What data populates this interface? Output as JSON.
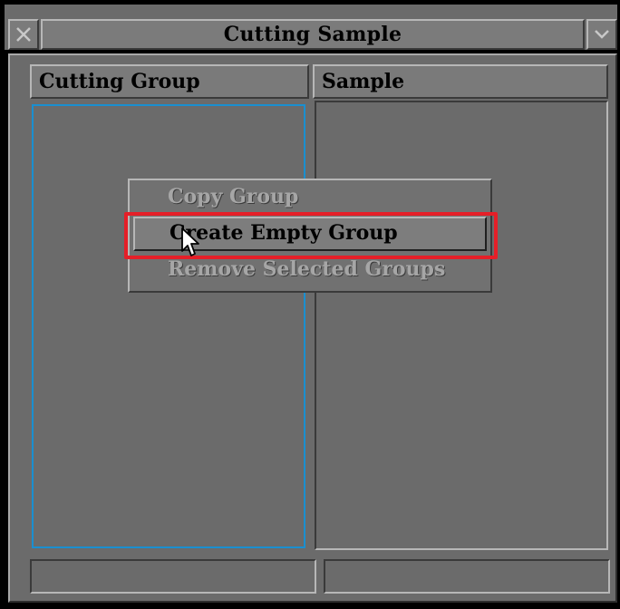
{
  "window": {
    "title": "Cutting Sample",
    "close_icon": "close-x-icon",
    "menu_icon": "chevron-down-icon"
  },
  "columns": {
    "left_header": "Cutting Group",
    "right_header": "Sample"
  },
  "context_menu": {
    "items": [
      {
        "label": "Copy Group",
        "enabled": false
      },
      {
        "label": "Create Empty Group",
        "enabled": true,
        "hovered": true
      },
      {
        "label": "Remove Selected Groups",
        "enabled": false
      }
    ]
  },
  "status": {
    "left": "",
    "right": ""
  },
  "colors": {
    "highlight": "#e51f28",
    "focus_border": "#1a8fd0",
    "background": "#6b6b6b"
  },
  "cursor_icon": "mouse-pointer-icon"
}
